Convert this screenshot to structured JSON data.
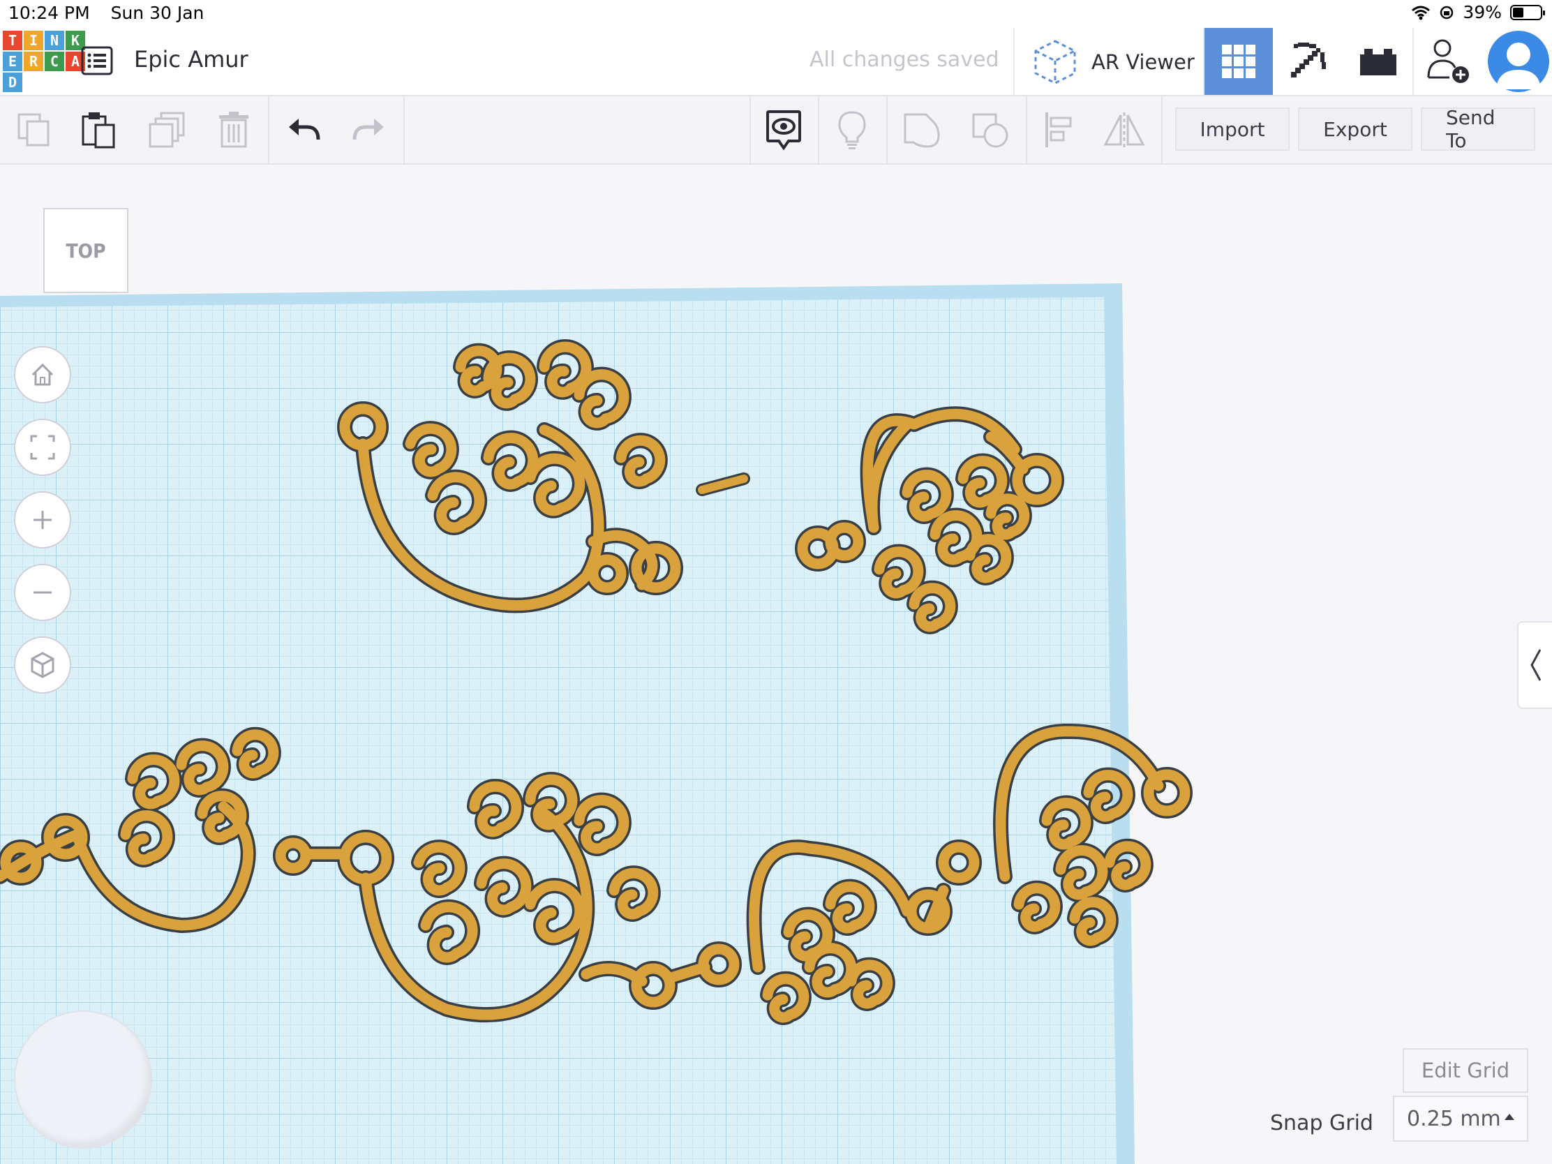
{
  "status_bar": {
    "time": "10:24 PM",
    "date": "Sun 30 Jan",
    "battery": "39%",
    "battery_level": 0.39
  },
  "header": {
    "logo_letters": [
      "T",
      "I",
      "N",
      "K",
      "E",
      "R",
      "C",
      "A",
      "D"
    ],
    "logo_colors": [
      "#e8462e",
      "#f0a52b",
      "#4aa0d8",
      "#3d9b4e",
      "#4aa0d8",
      "#f0a52b",
      "#3d9b4e",
      "#e8462e",
      "#4aa0d8"
    ],
    "project_title": "Epic Amur",
    "save_status": "All changes saved",
    "ar_viewer_label": "AR Viewer",
    "active_view_color": "#5a8fd8",
    "icons": [
      "list-icon",
      "ar-cube-icon",
      "grid-view-icon",
      "pickaxe-icon",
      "brick-icon",
      "add-user-icon",
      "avatar-icon"
    ]
  },
  "toolbar": {
    "import_label": "Import",
    "export_label": "Export",
    "send_to_label": "Send To",
    "icons": [
      "copy-icon",
      "paste-icon",
      "duplicate-icon",
      "delete-icon",
      "undo-icon",
      "redo-icon",
      "notes-icon",
      "light-bulb-icon",
      "group-icon",
      "ungroup-icon",
      "align-icon",
      "mirror-icon"
    ]
  },
  "canvas": {
    "view_cube_label": "TOP",
    "workplane_color": "#d9edf5",
    "object_color": "#d9a23c",
    "nav_icons": [
      "home-icon",
      "fit-view-icon",
      "zoom-in-icon",
      "zoom-out-icon",
      "perspective-icon"
    ],
    "edit_grid_label": "Edit Grid",
    "snap_grid_label": "Snap Grid",
    "snap_grid_value": "0.25 mm"
  }
}
